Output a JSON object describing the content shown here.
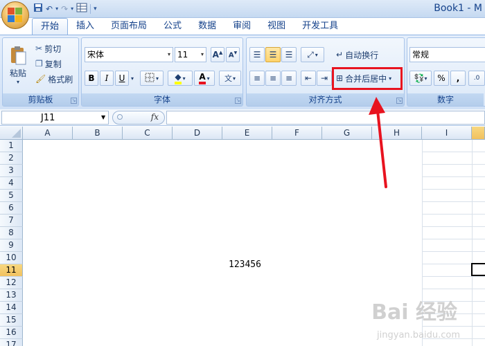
{
  "window": {
    "title": "Book1 - M"
  },
  "tabs": [
    {
      "label": "开始"
    },
    {
      "label": "插入"
    },
    {
      "label": "页面布局"
    },
    {
      "label": "公式"
    },
    {
      "label": "数据"
    },
    {
      "label": "审阅"
    },
    {
      "label": "视图"
    },
    {
      "label": "开发工具"
    }
  ],
  "clipboard": {
    "paste": "粘贴",
    "cut": "剪切",
    "copy": "复制",
    "format_painter": "格式刷",
    "group": "剪贴板"
  },
  "font": {
    "name": "宋体",
    "size": "11",
    "bold": "B",
    "italic": "I",
    "underline": "U",
    "color": "A",
    "group": "字体"
  },
  "alignment": {
    "wrap": "自动换行",
    "merge_center": "合并后居中",
    "group": "对齐方式"
  },
  "number": {
    "format": "常规",
    "percent": "%",
    "comma": ",",
    "group": "数字"
  },
  "formula_bar": {
    "name_box": "J11",
    "fx": "fx",
    "formula": ""
  },
  "columns": [
    "A",
    "B",
    "C",
    "D",
    "E",
    "F",
    "G",
    "H",
    "I"
  ],
  "rows": [
    "1",
    "2",
    "3",
    "4",
    "5",
    "6",
    "7",
    "8",
    "9",
    "10",
    "11",
    "12",
    "13",
    "14",
    "15",
    "16",
    "17"
  ],
  "selected_row": "11",
  "merged_cell_value": "123456",
  "watermark": {
    "brand": "Bai 经验",
    "url": "jingyan.baidu.com"
  },
  "colors": {
    "highlight": "#e8131f",
    "ribbon": "#d1e1f6",
    "selected_header": "#f1c15f"
  }
}
